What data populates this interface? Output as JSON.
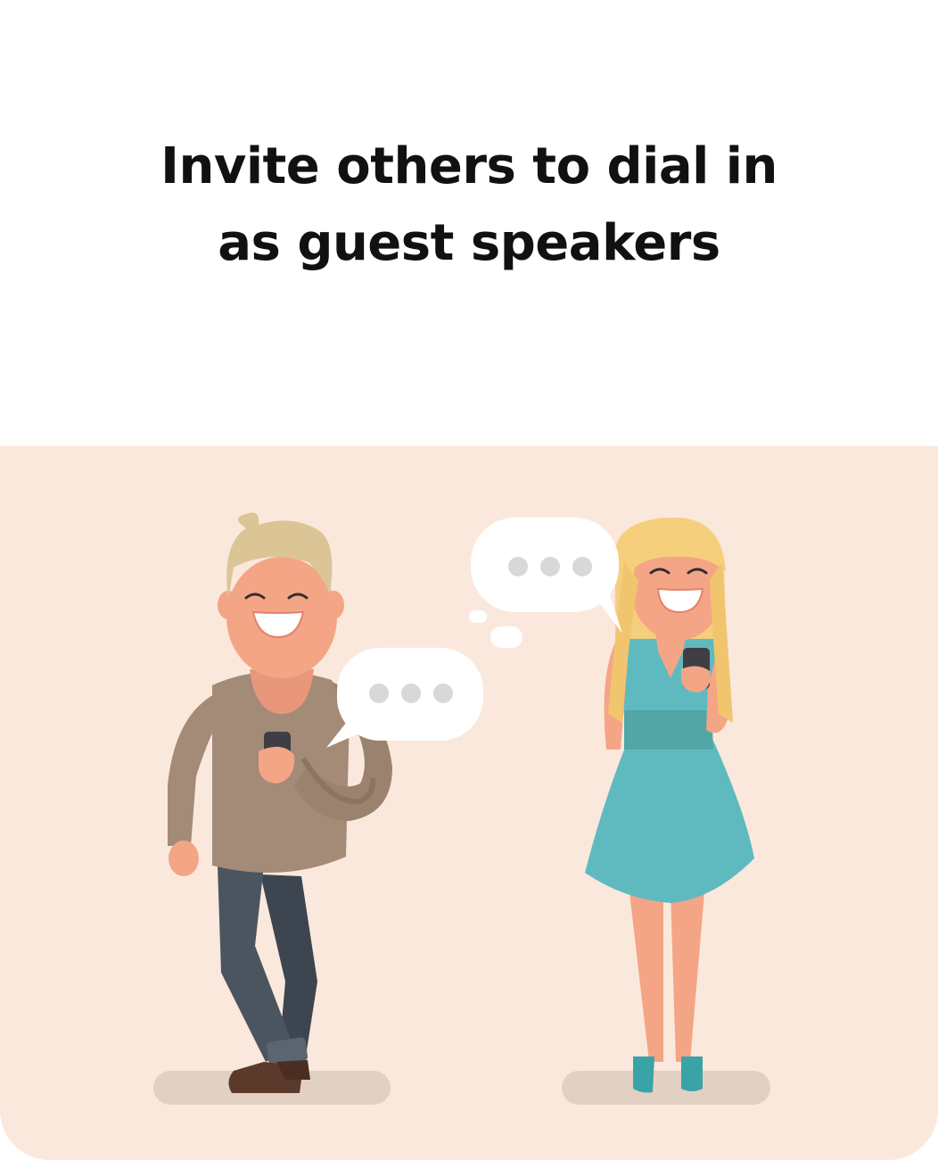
{
  "title": {
    "line1": "Invite others to dial in",
    "line2": "as guest speakers"
  },
  "illustration": {
    "description_icon": "two-people-chatting-on-phones-illustration",
    "background_color": "#fbe8dc"
  }
}
